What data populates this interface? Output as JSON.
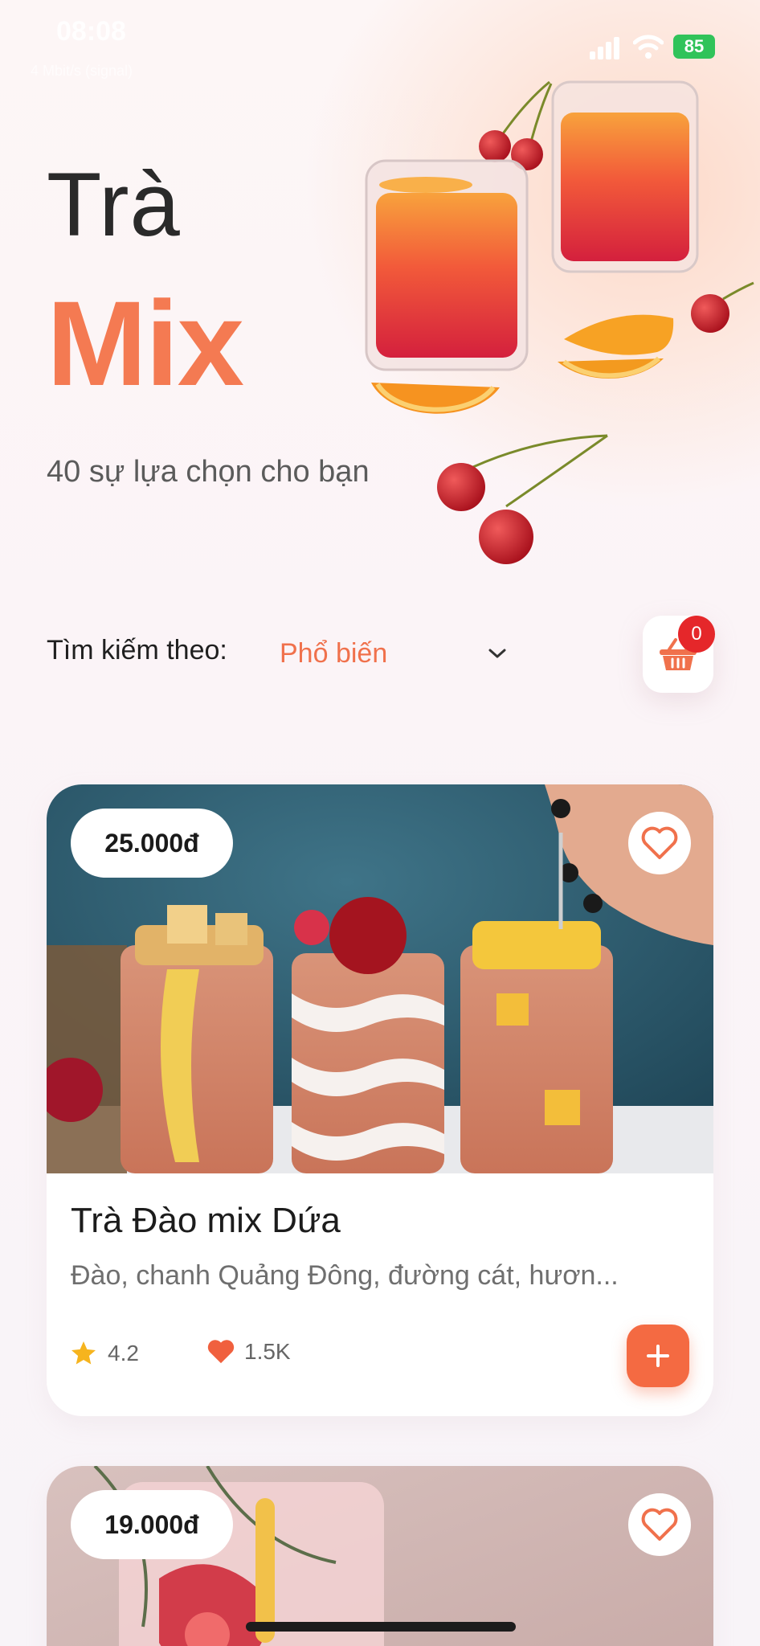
{
  "status_bar": {
    "time": "08:08",
    "carrier": "4 Mbit/s (signal)",
    "battery": "85"
  },
  "hero": {
    "title_line1": "Trà",
    "title_line2": "Mix",
    "subtitle": "40 sự lựa chọn cho bạn"
  },
  "search": {
    "label": "Tìm kiếm theo:",
    "sort_value": "Phổ biến",
    "cart_count": "0"
  },
  "products": [
    {
      "price": "25.000đ",
      "name": "Trà Đào mix Dứa",
      "description": "Đào, chanh Quảng Đông, đường cát, hươn...",
      "rating": "4.2",
      "likes": "1.5K"
    },
    {
      "price": "19.000đ"
    }
  ],
  "colors": {
    "accent": "#f47a52",
    "badge": "#e5272a",
    "star": "#f6b41e",
    "heart": "#f0603e"
  },
  "icons": [
    "signal-icon",
    "wifi-icon",
    "battery-icon",
    "chevron-down-icon",
    "basket-icon",
    "heart-outline-icon",
    "star-icon",
    "heart-icon",
    "plus-icon"
  ]
}
